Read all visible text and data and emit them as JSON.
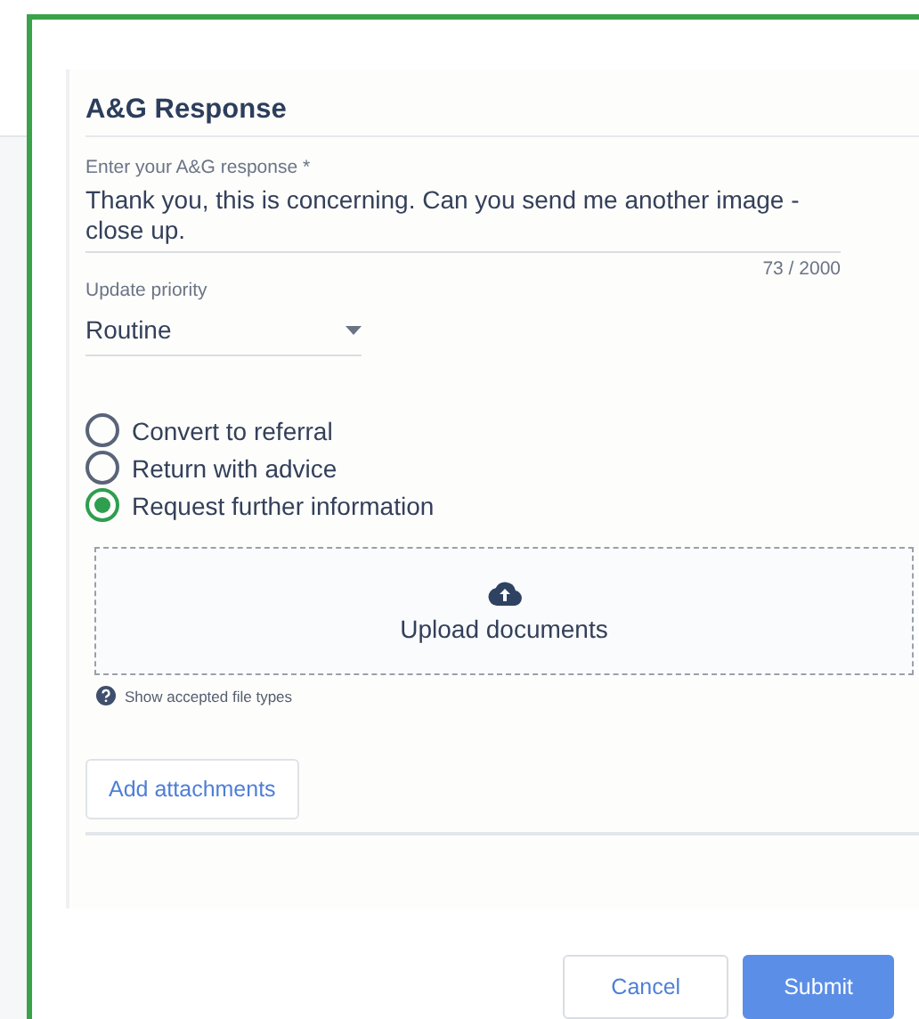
{
  "heading": "A&G Response",
  "response": {
    "label": "Enter your A&G response *",
    "value": "Thank you, this is concerning. Can you send me another image - close up.",
    "counter": "73 / 2000"
  },
  "priority": {
    "label": "Update priority",
    "value": "Routine"
  },
  "options": [
    {
      "label": "Convert to referral",
      "selected": false
    },
    {
      "label": "Return with advice",
      "selected": false
    },
    {
      "label": "Request further information",
      "selected": true
    }
  ],
  "upload": {
    "label": "Upload documents",
    "help": "Show accepted file types"
  },
  "attach_button": "Add attachments",
  "buttons": [
    {
      "label": "Cancel",
      "kind": "secondary"
    },
    {
      "label": "Submit",
      "kind": "primary"
    }
  ]
}
